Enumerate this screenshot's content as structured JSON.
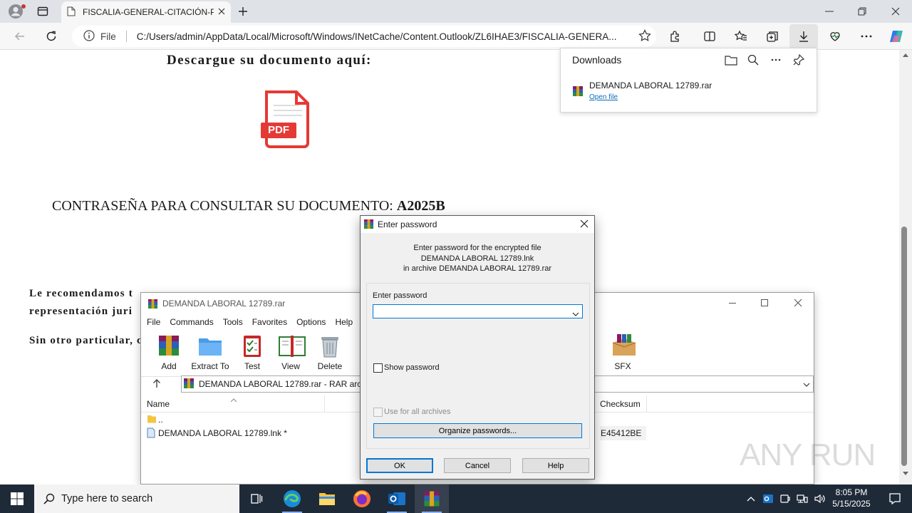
{
  "browser": {
    "tab_title": "FISCALIA-GENERAL-CITACIÓN-P",
    "url_scheme_label": "File",
    "url": "C:/Users/admin/AppData/Local/Microsoft/Windows/INetCache/Content.Outlook/ZL6IHAE3/FISCALIA-GENERA..."
  },
  "page": {
    "heading": "Descargue su documento aquí:",
    "pdf_label": "PDF",
    "password_prefix": "CONTRASEÑA PARA CONSULTAR SU DOCUMENTO: ",
    "password_value": "A2025B",
    "para1_line1": "Le recomendamos t",
    "para1_line2": "representación juri",
    "para2": "Sin otro particular, c"
  },
  "downloads": {
    "title": "Downloads",
    "item_name": "DEMANDA LABORAL 12789.rar",
    "item_action": "Open file"
  },
  "winrar": {
    "title": "DEMANDA LABORAL 12789.rar",
    "menu": [
      "File",
      "Commands",
      "Tools",
      "Favorites",
      "Options",
      "Help"
    ],
    "toolbar": {
      "add": "Add",
      "extract": "Extract To",
      "test": "Test",
      "view": "View",
      "delete": "Delete",
      "sfx": "SFX"
    },
    "path": "DEMANDA LABORAL 12789.rar - RAR archive",
    "columns": {
      "name": "Name",
      "checksum": "Checksum"
    },
    "rows": [
      {
        "name": "..",
        "checksum": ""
      },
      {
        "name": "DEMANDA LABORAL 12789.lnk *",
        "checksum": "E45412BE"
      }
    ]
  },
  "password_dialog": {
    "title": "Enter password",
    "msg_line1": "Enter password for the encrypted file",
    "msg_line2": "DEMANDA LABORAL 12789.lnk",
    "msg_line3": "in archive DEMANDA LABORAL 12789.rar",
    "field_label": "Enter password",
    "field_value": "",
    "show_password": "Show password",
    "use_all": "Use for all archives",
    "organize": "Organize passwords...",
    "ok": "OK",
    "cancel": "Cancel",
    "help": "Help"
  },
  "taskbar": {
    "search_placeholder": "Type here to search",
    "time": "8:05 PM",
    "date": "5/15/2025"
  },
  "watermark": "ANY RUN",
  "colors": {
    "accent": "#0078d7",
    "taskbar": "#1f2a38",
    "pdf_red": "#e53935",
    "link": "#0f6cbd"
  }
}
